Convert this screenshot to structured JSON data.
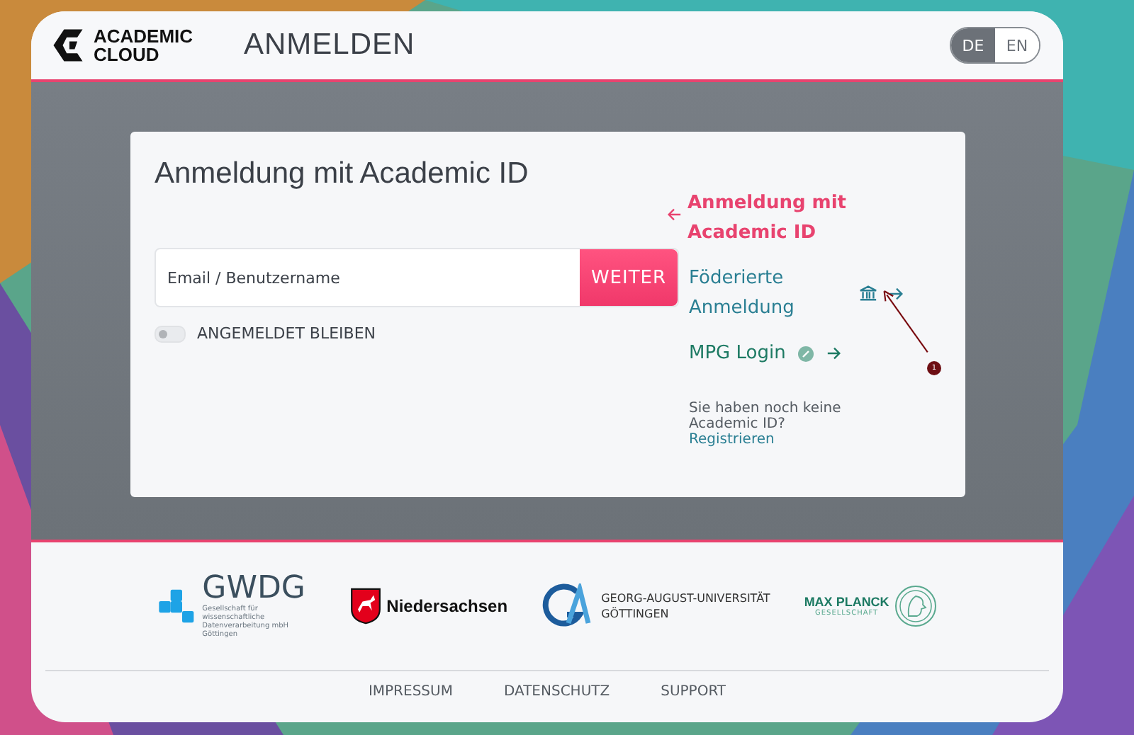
{
  "header": {
    "logo_lines": [
      "ACADEMIC",
      "CLOUD"
    ],
    "title": "ANMELDEN",
    "languages": [
      {
        "label": "DE",
        "selected": true
      },
      {
        "label": "EN",
        "selected": false
      }
    ]
  },
  "card": {
    "title": "Anmeldung mit Academic ID",
    "login": {
      "placeholder": "Email / Benutzername",
      "button": "WEITER"
    },
    "remember": {
      "label": "ANGEMELDET BLEIBEN",
      "on": false
    },
    "methods": [
      {
        "kind": "back",
        "label": "Anmeldung mit Academic ID"
      },
      {
        "kind": "institution",
        "label": "Föderierte Anmeldung"
      },
      {
        "kind": "mpg",
        "label": "MPG Login"
      }
    ],
    "annotation": {
      "label": "1"
    },
    "register": {
      "text": "Sie haben noch keine Academic ID?",
      "link": "Registrieren"
    }
  },
  "footer": {
    "logos": [
      {
        "kind": "gwdg",
        "name": "GWDG",
        "subtitle": "Gesellschaft für wissenschaftliche Datenverarbeitung mbH Göttingen"
      },
      {
        "kind": "nds",
        "name": "Niedersachsen"
      },
      {
        "kind": "uni",
        "lines": [
          "GEORG-AUGUST-UNIVERSITÄT",
          "GÖTTINGEN"
        ]
      },
      {
        "kind": "mpg",
        "name": "MAX PLANCK",
        "subtitle": "GESELLSCHAFT"
      }
    ],
    "links": [
      "IMPRESSUM",
      "DATENSCHUTZ",
      "SUPPORT"
    ]
  }
}
